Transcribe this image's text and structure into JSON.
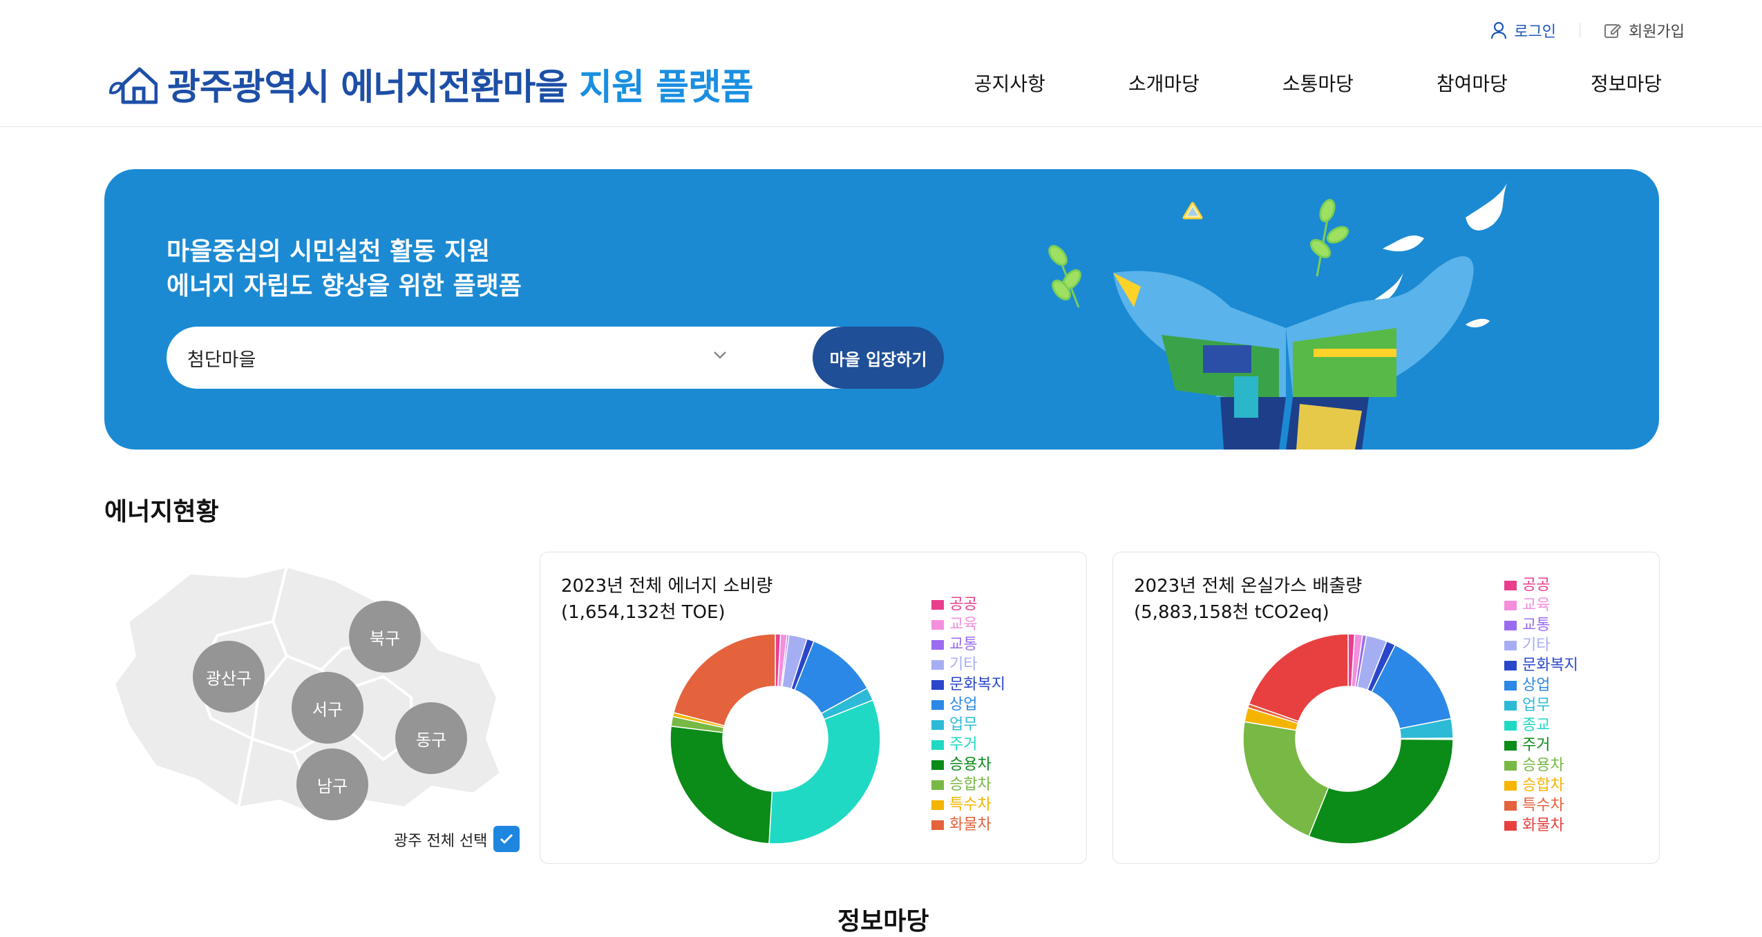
{
  "header": {
    "login": "로그인",
    "join": "회원가입",
    "title_main": "광주광역시 에너지전환마을",
    "title_accent": "지원 플랫폼",
    "nav": [
      "공지사항",
      "소개마당",
      "소통마당",
      "참여마당",
      "정보마당"
    ]
  },
  "banner": {
    "line1": "마을중심의 시민실천 활동 지원",
    "line2": "에너지 자립도 향상을 위한 플랫폼",
    "selected_village": "첨단마을",
    "enter_button": "마을 입장하기"
  },
  "energy": {
    "section_title": "에너지현황",
    "districts": [
      "광산구",
      "북구",
      "서구",
      "동구",
      "남구"
    ],
    "all_select_label": "광주 전체 선택",
    "all_select_checked": true
  },
  "chart_data": [
    {
      "type": "pie",
      "title": "2023년 전체 에너지 소비량",
      "subtitle": "(1,654,132천 TOE)",
      "categories": [
        "공공",
        "교육",
        "교통",
        "기타",
        "문화복지",
        "상업",
        "업무",
        "주거",
        "승용차",
        "승합차",
        "특수차",
        "화물차"
      ],
      "values": [
        0.8,
        1.0,
        0.3,
        2.8,
        1.1,
        11.0,
        2.0,
        32.0,
        26.0,
        1.5,
        0.6,
        21.0
      ],
      "colors": [
        "#e83e8c",
        "#f48fdd",
        "#9b6cf0",
        "#a6aef3",
        "#2a46c9",
        "#2b88e6",
        "#2cbad7",
        "#20d9c4",
        "#0b8b18",
        "#78b845",
        "#f4b400",
        "#e4623c"
      ],
      "legend_position": "right"
    },
    {
      "type": "pie",
      "title": "2023년 전체 온실가스 배출량",
      "subtitle": "(5,883,158천 tCO2eq)",
      "categories": [
        "공공",
        "교육",
        "교통",
        "기타",
        "문화복지",
        "상업",
        "업무",
        "종교",
        "주거",
        "승용차",
        "승합차",
        "특수차",
        "화물차"
      ],
      "values": [
        1.0,
        1.2,
        0.6,
        3.2,
        1.4,
        14.5,
        3.0,
        0.2,
        31.0,
        21.5,
        2.2,
        0.6,
        19.6
      ],
      "colors": [
        "#e83e8c",
        "#f48fdd",
        "#9b6cf0",
        "#a6aef3",
        "#2a46c9",
        "#2b88e6",
        "#2cbad7",
        "#20d9c4",
        "#0b8b18",
        "#78b845",
        "#f4b400",
        "#e4623c",
        "#e84040"
      ],
      "legend_position": "right"
    }
  ],
  "info_section_title": "정보마당"
}
